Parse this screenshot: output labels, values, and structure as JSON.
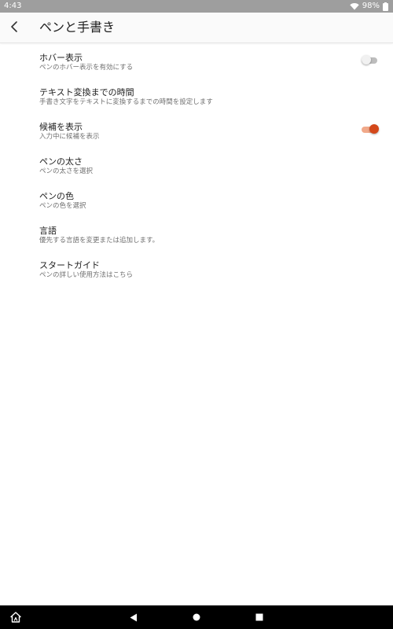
{
  "status_bar": {
    "time": "4:43",
    "battery": "98%",
    "icons": [
      "wifi-icon"
    ]
  },
  "app_bar": {
    "title": "ペンと手書き",
    "back_icon": "back-arrow-icon"
  },
  "settings": [
    {
      "title": "ホバー表示",
      "summary": "ペンのホバー表示を有効にする",
      "toggle": false
    },
    {
      "title": "テキスト変換までの時間",
      "summary": "手書き文字をテキストに変換するまでの時間を設定します"
    },
    {
      "title": "候補を表示",
      "summary": "入力中に候補を表示",
      "toggle": true
    },
    {
      "title": "ペンの太さ",
      "summary": "ペンの太さを選択"
    },
    {
      "title": "ペンの色",
      "summary": "ペンの色を選択"
    },
    {
      "title": "言語",
      "summary": "優先する言語を変更または追加します。"
    },
    {
      "title": "スタートガイド",
      "summary": "ペンの詳しい使用方法はこちら"
    }
  ],
  "nav_bar": {
    "buttons": [
      "home-alexa-icon",
      "back-triangle-icon",
      "home-circle-icon",
      "recents-square-icon"
    ]
  },
  "colors": {
    "accent": "#d4481a",
    "accent_track": "#f1a98a",
    "status_bar": "#9e9e9e",
    "nav_bar": "#000000"
  }
}
